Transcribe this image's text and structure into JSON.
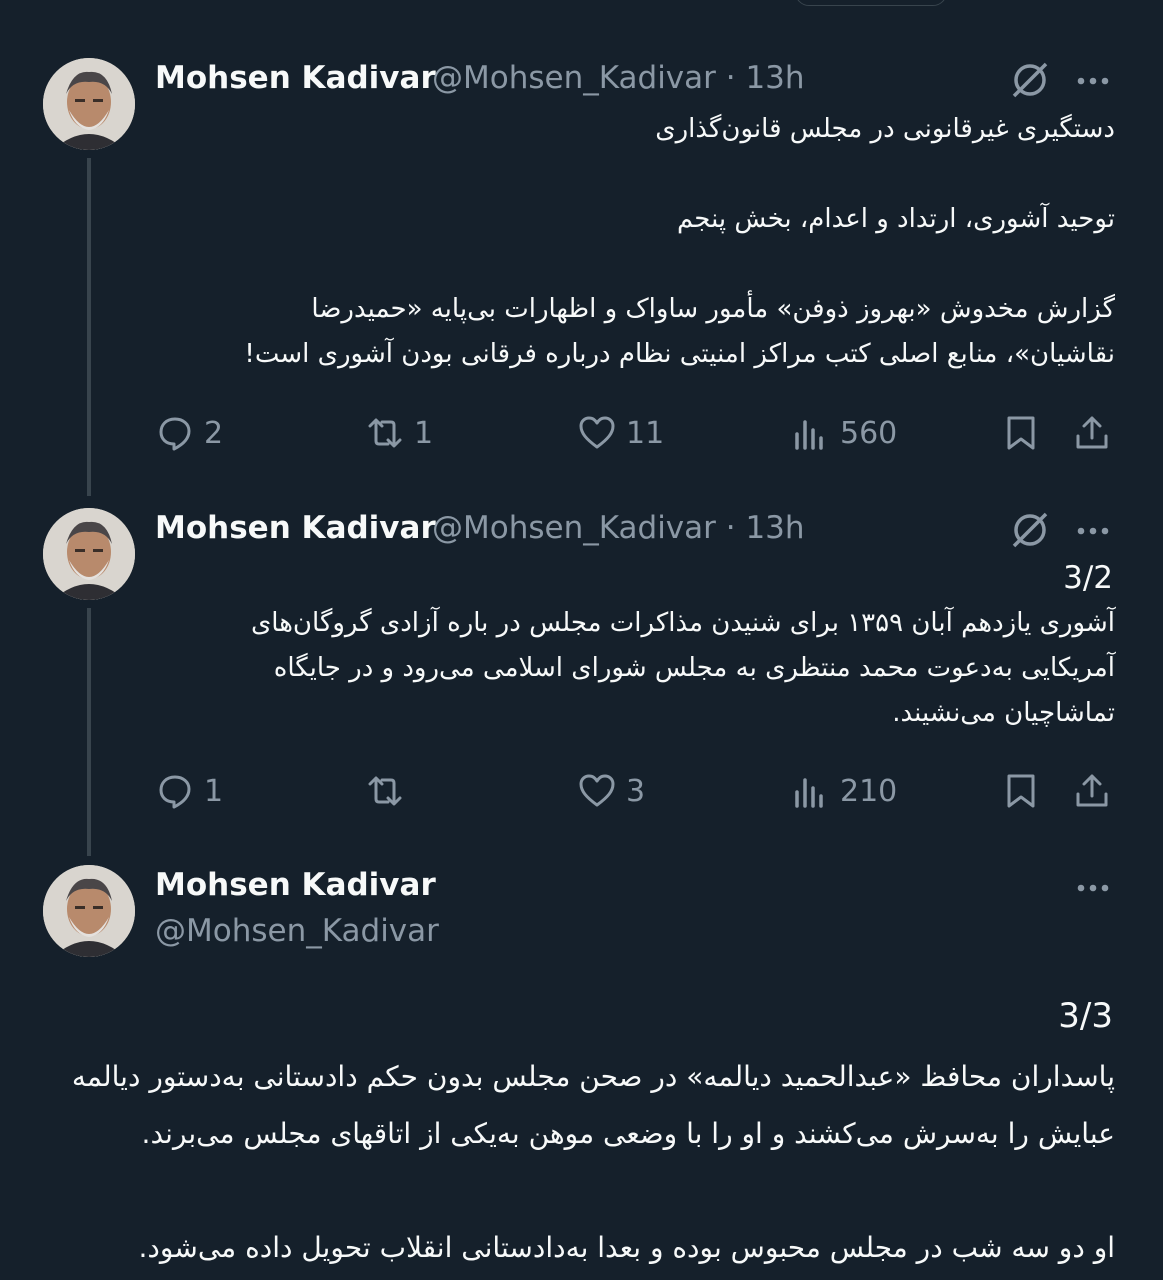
{
  "tweets": [
    {
      "author": "Mohsen Kadivar",
      "handle_time": "@Mohsen_Kadivar · 13h",
      "text": "دستگیری غیرقانونی در مجلس قانون‌گذاری\n\nتوحید آشوری، ارتداد و اعدام، بخش پنجم\n\nگزارش مخدوش «بهروز ذوفن» مأمور ساواک و اظهارات بی‌پایه «حمیدرضا\nنقاشیان»، منابع اصلی کتب مراکز امنیتی نظام درباره فرقانی بودن آشوری است!",
      "replies": "2",
      "retweets": "1",
      "likes": "11",
      "views": "560"
    },
    {
      "author": "Mohsen Kadivar",
      "handle_time": "@Mohsen_Kadivar · 13h",
      "thread_number": "3/2",
      "text": "آشوری یازدهم آبان ۱۳۵۹ برای شنیدن مذاکرات مجلس در باره آزادی گروگان‌های\nآمریکایی به‌دعوت محمد منتظری به مجلس شورای اسلامی می‌رود و در جایگاه\nتماشاچیان می‌نشیند.",
      "replies": "1",
      "retweets": "",
      "likes": "3",
      "views": "210"
    },
    {
      "author": "Mohsen Kadivar",
      "handle": "@Mohsen_Kadivar",
      "thread_number": "3/3",
      "text": "پاسداران محافظ «عبدالحمید دیالمه» در صحن مجلس بدون حکم دادستانی به‌دستور دیالمه\nعبایش را به‌سرش می‌کشند و او را با وضعی موهن به‌یکی از اتاقهای مجلس می‌برند.\n\nاو دو سه شب در مجلس محبوس بوده و بعدا به‌دادستانی انقلاب تحویل داده می‌شود."
    }
  ],
  "icons": {
    "reply": "reply-icon",
    "retweet": "retweet-icon",
    "like": "heart-icon",
    "views": "views-icon",
    "bookmark": "bookmark-icon",
    "share": "share-icon",
    "grok": "grok-icon",
    "more": "more-icon"
  },
  "colors": {
    "background": "#15202b",
    "text": "#f7f9f9",
    "muted": "#8b98a5",
    "thread_line": "#38444d"
  }
}
